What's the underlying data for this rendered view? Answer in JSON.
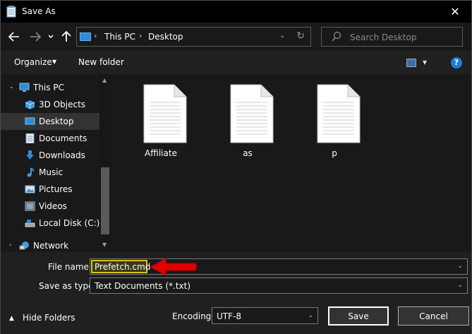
{
  "window": {
    "title": "Save As",
    "close_glyph": "✕"
  },
  "nav": {
    "breadcrumbs": [
      "This PC",
      "Desktop"
    ],
    "search_placeholder": "Search Desktop"
  },
  "toolbar": {
    "organize_label": "Organize",
    "new_folder_label": "New folder",
    "help_glyph": "?"
  },
  "sidebar": {
    "items": [
      {
        "label": "This PC",
        "icon": "computer-icon"
      },
      {
        "label": "3D Objects",
        "icon": "cube-icon"
      },
      {
        "label": "Desktop",
        "icon": "desktop-icon",
        "selected": true
      },
      {
        "label": "Documents",
        "icon": "document-icon"
      },
      {
        "label": "Downloads",
        "icon": "download-arrow-icon"
      },
      {
        "label": "Music",
        "icon": "music-note-icon"
      },
      {
        "label": "Pictures",
        "icon": "picture-icon"
      },
      {
        "label": "Videos",
        "icon": "video-icon"
      },
      {
        "label": "Local Disk (C:)",
        "icon": "drive-icon"
      },
      {
        "label": "Network",
        "icon": "network-icon"
      }
    ]
  },
  "files": [
    {
      "name": "Affiliate",
      "icon": "text-file-icon"
    },
    {
      "name": "as",
      "icon": "text-file-icon"
    },
    {
      "name": "p",
      "icon": "text-file-icon"
    }
  ],
  "form": {
    "file_name_label": "File name:",
    "file_name_value": "Prefetch.cmd",
    "save_type_label": "Save as type:",
    "save_type_value": "Text Documents (*.txt)",
    "hide_folders_label": "Hide Folders",
    "encoding_label": "Encoding:",
    "encoding_value": "UTF-8",
    "save_label": "Save",
    "cancel_label": "Cancel"
  },
  "colors": {
    "accent": "#2f8ad8",
    "highlight_border": "#d9c21a",
    "annotation_arrow": "#e00000"
  }
}
